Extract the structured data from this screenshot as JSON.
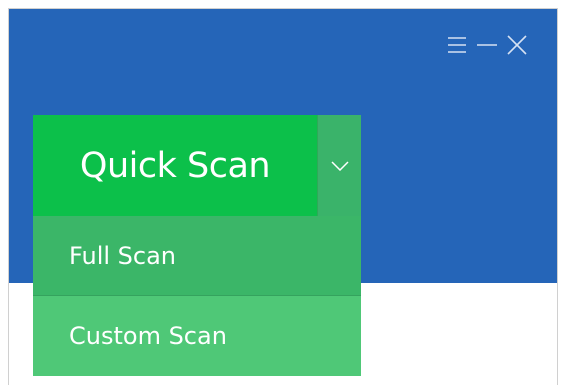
{
  "window": {
    "header_color": "#2565b8",
    "controls": [
      {
        "name": "menu",
        "icon": "hamburger-menu-icon"
      },
      {
        "name": "minimize",
        "icon": "minimize-icon"
      },
      {
        "name": "close",
        "icon": "close-icon"
      }
    ]
  },
  "scan": {
    "primary_label": "Quick Scan",
    "primary_color": "#0cc04a",
    "toggle_icon": "chevron-down-icon",
    "menu_items": [
      {
        "label": "Full Scan"
      },
      {
        "label": "Custom Scan"
      }
    ]
  }
}
